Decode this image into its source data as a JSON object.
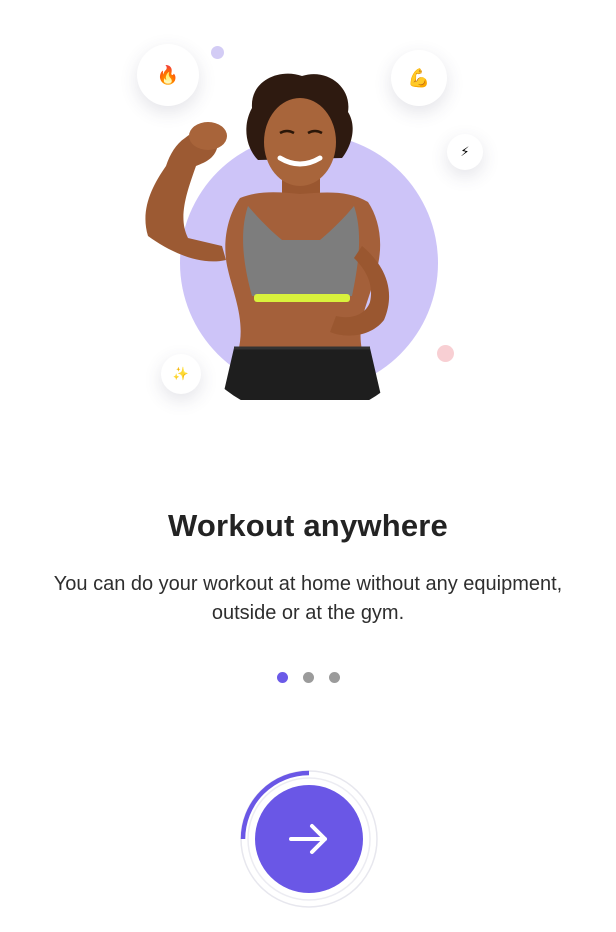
{
  "hero": {
    "badges": [
      {
        "name": "fire",
        "glyph": "🔥"
      },
      {
        "name": "flexed-biceps",
        "glyph": "💪"
      },
      {
        "name": "lightning",
        "glyph": "⚡"
      },
      {
        "name": "sparkles",
        "glyph": "✨"
      }
    ],
    "accent_color": "#cdc4f8"
  },
  "onboarding": {
    "title": "Workout anywhere",
    "description": "You can do your workout at home without any equipment, outside or at the gym."
  },
  "pager": {
    "total": 3,
    "current": 1,
    "active_color": "#6b5ae8",
    "inactive_color": "#9b9b9b"
  },
  "next_button": {
    "icon": "arrow-right-icon",
    "color": "#6a57e6",
    "progress": 0.25
  }
}
